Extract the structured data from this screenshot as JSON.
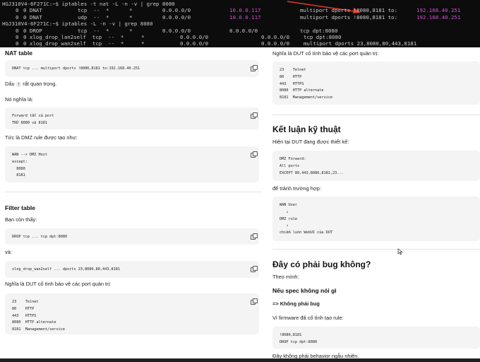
{
  "terminal": {
    "rows": [
      [
        {
          "t": "HGJ310V4-6F271C:~$ iptables -t nat -L -n -v | grep 8080"
        }
      ],
      [
        {
          "t": "0"
        },
        {
          "t": "0 DNAT"
        },
        {
          "t": "tcp  --  *"
        },
        {
          "t": "*"
        },
        {
          "t": "0.0.0.0/0"
        },
        {
          "t": "10.0.0.117",
          "pink": true
        },
        {
          "t": "multiport dports !8080,8181 to:"
        },
        {
          "t": "192.168.40.251",
          "pink": true
        }
      ],
      [
        {
          "t": "0"
        },
        {
          "t": "0 DNAT"
        },
        {
          "t": "udp  --  *"
        },
        {
          "t": "*"
        },
        {
          "t": "0.0.0.0/0"
        },
        {
          "t": "10.0.0.117",
          "pink": true
        },
        {
          "t": "multiport dports !8080,8181 to:"
        },
        {
          "t": "192.168.40.251",
          "pink": true
        }
      ],
      [
        {
          "t": "HGJ310V4-6F271C:~$ iptables -L -n -v | grep 8080"
        }
      ],
      [
        {
          "t": "0"
        },
        {
          "t": "0 DROP"
        },
        {
          "t": "tcp  --  *"
        },
        {
          "t": "*"
        },
        {
          "t": "0.0.0.0/0"
        },
        {
          "t": "0.0.0.0/0"
        },
        {
          "t": "tcp dpt:8080"
        }
      ],
      [
        {
          "t": "0"
        },
        {
          "t": "0 xlog_drop_lan2self  tcp  --  *"
        },
        {
          "t": "*"
        },
        {
          "t": "0.0.0.0/0"
        },
        {
          "t": "0.0.0.0/0"
        },
        {
          "t": "tcp dpt:8080"
        }
      ],
      [
        {
          "t": "0"
        },
        {
          "t": "0 xlog_drop_wan2self  tcp  --  *"
        },
        {
          "t": "*"
        },
        {
          "t": "0.0.0.0/0"
        },
        {
          "t": "0.0.0.0/0"
        },
        {
          "t": "multiport dports 23,8080,80,443,8181"
        }
      ]
    ]
  },
  "left": {
    "nat_heading": "NAT table",
    "nat_code": "DNAT tcp ... multiport dports !8080,8181 to:192.168.40.251",
    "dau_pre": "Dấu ",
    "dau_code": "!",
    "dau_post": " rất quan trọng.",
    "nghia_la": "Nó nghĩa là:",
    "forward_code": "Forward tất cả port\nTRỪ 8080 và 8181",
    "dmz_intro": "Tức là DMZ rule được tạo như:",
    "dmz_code": "WAN --> DMZ Host\nexcept:\n  8080\n  8181",
    "filter_heading": "Filter table",
    "con_thay": "Bạn còn thấy:",
    "drop_code": "DROP tcp ... tcp dpt:8080",
    "va": "và:",
    "xlog_code": "xlog_drop_wan2self ... dports 23,8080,80,443,8181",
    "dut_protect": "Nghĩa là DUT cố tình bảo vệ các port quản trị:",
    "ports_code": "23    Telnet\n80    HTTP\n443   HTTPS\n8080  HTTP alternate\n8181  Management/service"
  },
  "right": {
    "dut_protect": "Nghĩa là DUT cố tình bảo vệ các port quản trị:",
    "ports_code": "23    Telnet\n80    HTTP\n443   HTTPS\n8080  HTTP alternate\n8181  Management/service",
    "ket_luan": "Kết luận kỹ thuật",
    "hien_tai": "Hiện tại DUT đang được thiết kế:",
    "dmz_forward_code": "DMZ Forward:\nAll ports\nEXCEPT 80,443,8080,8181,23...",
    "de_tranh": "để tránh trường hợp:",
    "flow_code": "WAN User\n   ↓\nDMZ rule\n   ↓\nchiếm luôn WebUI của DUT",
    "bug_heading": "Đây có phải bug không?",
    "theo_minh": "Theo mình:",
    "spec_heading": "Nếu spec không nói gì",
    "khong_bug_arrow": "=> ",
    "khong_bug": "Không phải bug",
    "vi_firmware": "Vì firmware đã cố tình tạo rule:",
    "rule_code": "!8080,8181\nDROP tcp dpt:8080",
    "behavior": "Đây không phải behavior ngẫu nhiên."
  },
  "colors": {
    "terminal_bg": "#0c0c0c",
    "terminal_fg": "#cccccc",
    "terminal_pink": "#d54fd4",
    "arrow": "#e0392b",
    "code_bg": "#f4f4f4"
  }
}
